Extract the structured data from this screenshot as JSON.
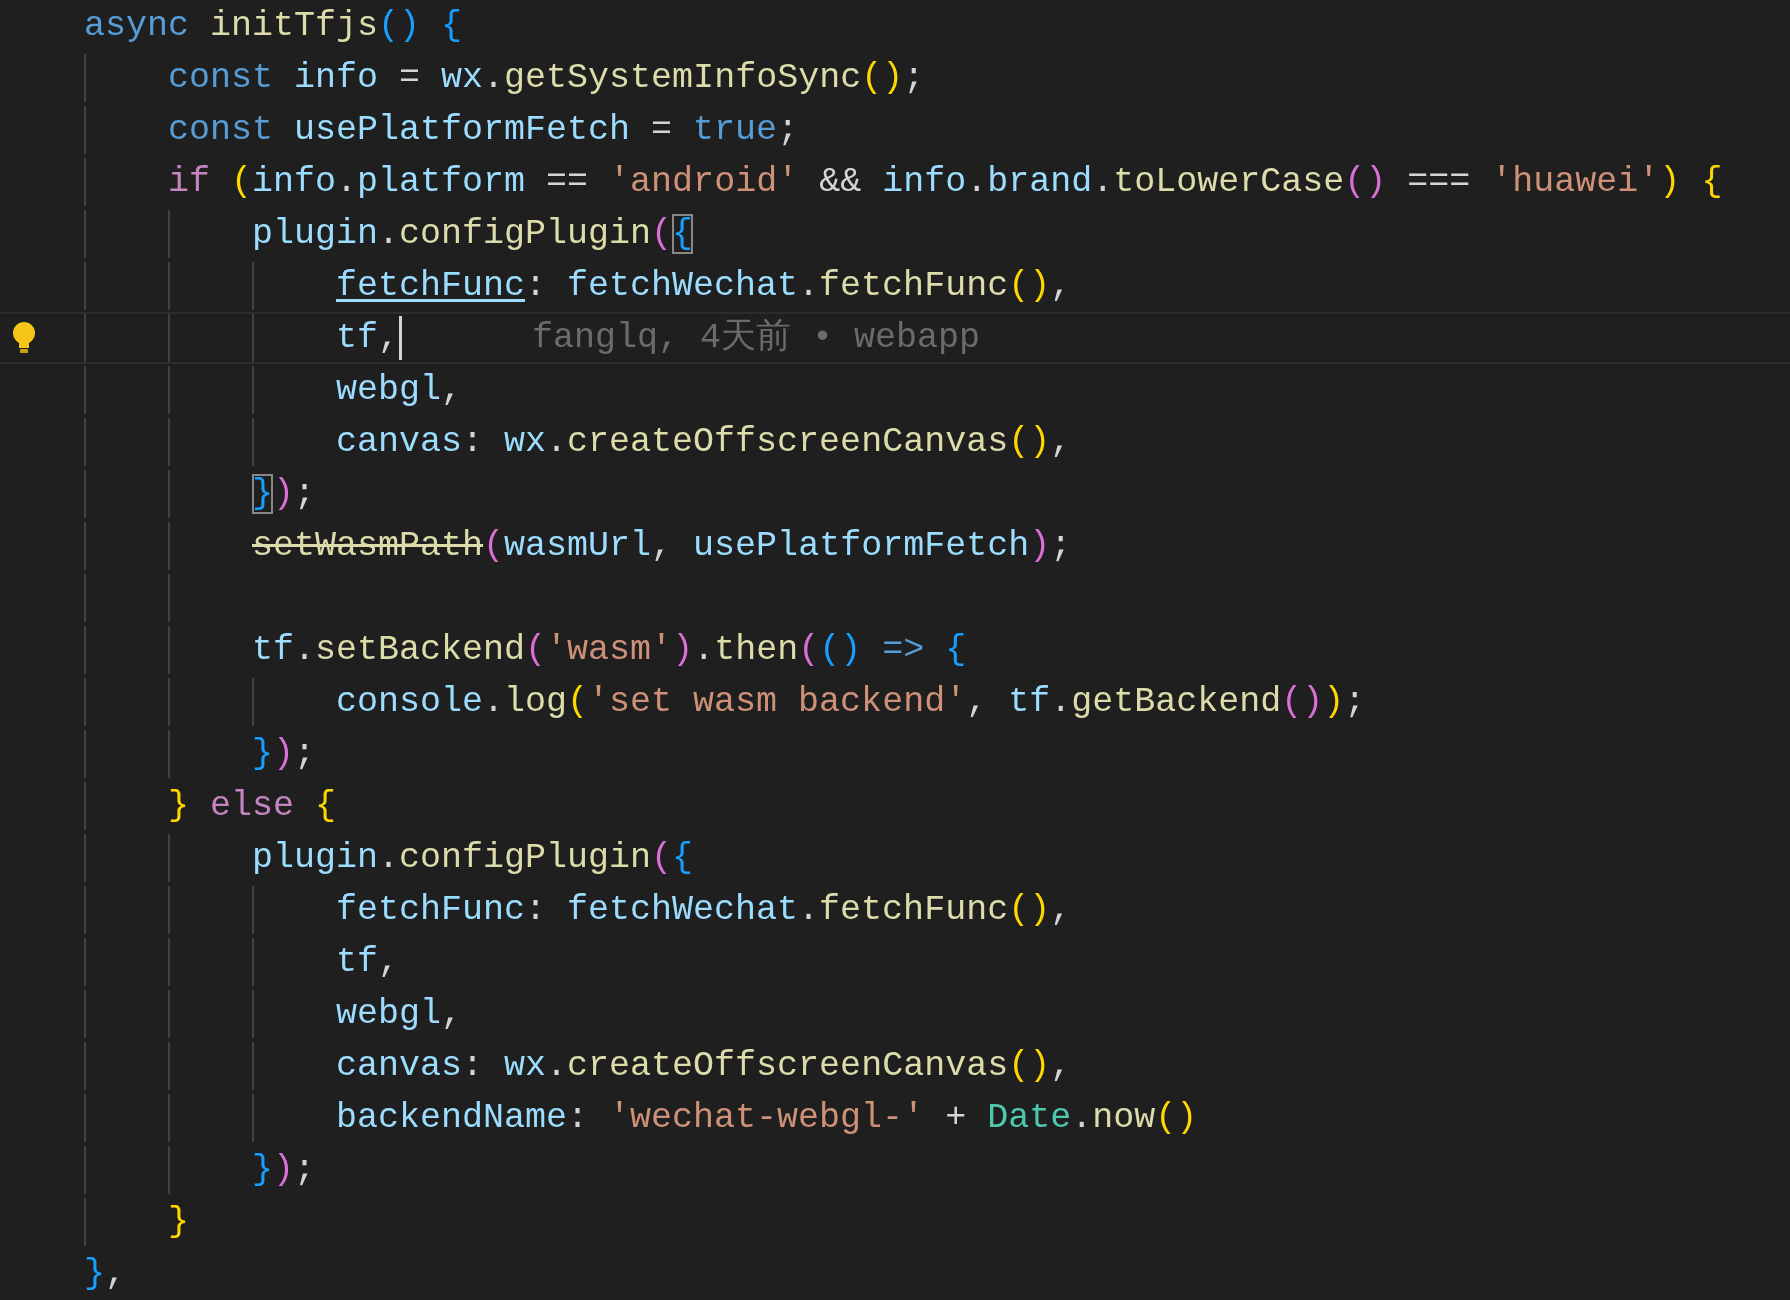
{
  "lines": [
    {
      "current": false,
      "tokens": [
        {
          "text": "async ",
          "kind": "keyword"
        },
        {
          "text": "initTfjs",
          "kind": "function"
        },
        {
          "text": "() ",
          "kind": "b3"
        },
        {
          "text": "{",
          "kind": "b3"
        }
      ],
      "children": [
        {
          "current": false,
          "tokens": [
            {
              "text": "const ",
              "kind": "keyword"
            },
            {
              "text": "info",
              "kind": "variable"
            },
            {
              "text": " = ",
              "kind": "plain"
            },
            {
              "text": "wx",
              "kind": "variable"
            },
            {
              "text": ".",
              "kind": "plain"
            },
            {
              "text": "getSystemInfoSync",
              "kind": "function"
            },
            {
              "text": "()",
              "kind": "b1"
            },
            {
              "text": ";",
              "kind": "plain"
            }
          ]
        },
        {
          "current": false,
          "tokens": [
            {
              "text": "const ",
              "kind": "keyword"
            },
            {
              "text": "usePlatformFetch",
              "kind": "variable"
            },
            {
              "text": " = ",
              "kind": "plain"
            },
            {
              "text": "true",
              "kind": "keyword"
            },
            {
              "text": ";",
              "kind": "plain"
            }
          ]
        },
        {
          "current": false,
          "tokens": [
            {
              "text": "if ",
              "kind": "control"
            },
            {
              "text": "(",
              "kind": "b1"
            },
            {
              "text": "info",
              "kind": "variable"
            },
            {
              "text": ".",
              "kind": "plain"
            },
            {
              "text": "platform",
              "kind": "variable"
            },
            {
              "text": " == ",
              "kind": "plain"
            },
            {
              "text": "'android'",
              "kind": "string"
            },
            {
              "text": " && ",
              "kind": "plain"
            },
            {
              "text": "info",
              "kind": "variable"
            },
            {
              "text": ".",
              "kind": "plain"
            },
            {
              "text": "brand",
              "kind": "variable"
            },
            {
              "text": ".",
              "kind": "plain"
            },
            {
              "text": "toLowerCase",
              "kind": "function"
            },
            {
              "text": "()",
              "kind": "b2"
            },
            {
              "text": " === ",
              "kind": "plain"
            },
            {
              "text": "'huawei'",
              "kind": "string"
            },
            {
              "text": ") ",
              "kind": "b1"
            },
            {
              "text": "{",
              "kind": "b1"
            }
          ],
          "children": [
            {
              "current": false,
              "tokens": [
                {
                  "text": "plugin",
                  "kind": "variable"
                },
                {
                  "text": ".",
                  "kind": "plain"
                },
                {
                  "text": "configPlugin",
                  "kind": "function"
                },
                {
                  "text": "(",
                  "kind": "b2"
                },
                {
                  "text": "{",
                  "kind": "b3",
                  "match": true
                }
              ],
              "children": [
                {
                  "current": false,
                  "tokens": [
                    {
                      "text": "fetchFunc",
                      "kind": "link"
                    },
                    {
                      "text": ": ",
                      "kind": "plain"
                    },
                    {
                      "text": "fetchWechat",
                      "kind": "variable"
                    },
                    {
                      "text": ".",
                      "kind": "plain"
                    },
                    {
                      "text": "fetchFunc",
                      "kind": "function"
                    },
                    {
                      "text": "()",
                      "kind": "b1"
                    },
                    {
                      "text": ",",
                      "kind": "plain"
                    }
                  ]
                },
                {
                  "current": true,
                  "blame": "fanglq, 4天前 • webapp",
                  "tokens": [
                    {
                      "text": "tf",
                      "kind": "variable"
                    },
                    {
                      "text": ",",
                      "kind": "plain"
                    }
                  ]
                },
                {
                  "current": false,
                  "tokens": [
                    {
                      "text": "webgl",
                      "kind": "variable"
                    },
                    {
                      "text": ",",
                      "kind": "plain"
                    }
                  ]
                },
                {
                  "current": false,
                  "tokens": [
                    {
                      "text": "canvas",
                      "kind": "variable"
                    },
                    {
                      "text": ": ",
                      "kind": "plain"
                    },
                    {
                      "text": "wx",
                      "kind": "variable"
                    },
                    {
                      "text": ".",
                      "kind": "plain"
                    },
                    {
                      "text": "createOffscreenCanvas",
                      "kind": "function"
                    },
                    {
                      "text": "()",
                      "kind": "b1"
                    },
                    {
                      "text": ",",
                      "kind": "plain"
                    }
                  ]
                }
              ]
            },
            {
              "current": false,
              "tokens": [
                {
                  "text": "}",
                  "kind": "b3",
                  "match": true
                },
                {
                  "text": ")",
                  "kind": "b2"
                },
                {
                  "text": ";",
                  "kind": "plain"
                }
              ]
            },
            {
              "current": false,
              "tokens": [
                {
                  "text": "setWasmPath",
                  "kind": "deprecated"
                },
                {
                  "text": "(",
                  "kind": "b2"
                },
                {
                  "text": "wasmUrl",
                  "kind": "variable"
                },
                {
                  "text": ", ",
                  "kind": "plain"
                },
                {
                  "text": "usePlatformFetch",
                  "kind": "variable"
                },
                {
                  "text": ")",
                  "kind": "b2"
                },
                {
                  "text": ";",
                  "kind": "plain"
                }
              ]
            },
            {
              "current": false
            },
            {
              "current": false,
              "tokens": [
                {
                  "text": "tf",
                  "kind": "variable"
                },
                {
                  "text": ".",
                  "kind": "plain"
                },
                {
                  "text": "setBackend",
                  "kind": "function"
                },
                {
                  "text": "(",
                  "kind": "b2"
                },
                {
                  "text": "'wasm'",
                  "kind": "string"
                },
                {
                  "text": ")",
                  "kind": "b2"
                },
                {
                  "text": ".",
                  "kind": "plain"
                },
                {
                  "text": "then",
                  "kind": "function"
                },
                {
                  "text": "(",
                  "kind": "b2"
                },
                {
                  "text": "() ",
                  "kind": "b3"
                },
                {
                  "text": "=> ",
                  "kind": "keyword"
                },
                {
                  "text": "{",
                  "kind": "b3"
                }
              ],
              "children": [
                {
                  "current": false,
                  "tokens": [
                    {
                      "text": "console",
                      "kind": "variable"
                    },
                    {
                      "text": ".",
                      "kind": "plain"
                    },
                    {
                      "text": "log",
                      "kind": "function"
                    },
                    {
                      "text": "(",
                      "kind": "b1"
                    },
                    {
                      "text": "'set wasm backend'",
                      "kind": "string"
                    },
                    {
                      "text": ", ",
                      "kind": "plain"
                    },
                    {
                      "text": "tf",
                      "kind": "variable"
                    },
                    {
                      "text": ".",
                      "kind": "plain"
                    },
                    {
                      "text": "getBackend",
                      "kind": "function"
                    },
                    {
                      "text": "()",
                      "kind": "b2"
                    },
                    {
                      "text": ")",
                      "kind": "b1"
                    },
                    {
                      "text": ";",
                      "kind": "plain"
                    }
                  ]
                }
              ]
            },
            {
              "current": false,
              "tokens": [
                {
                  "text": "}",
                  "kind": "b3"
                },
                {
                  "text": ")",
                  "kind": "b2"
                },
                {
                  "text": ";",
                  "kind": "plain"
                }
              ]
            }
          ]
        },
        {
          "current": false,
          "tokens": [
            {
              "text": "} ",
              "kind": "b1"
            },
            {
              "text": "else ",
              "kind": "control"
            },
            {
              "text": "{",
              "kind": "b1"
            }
          ],
          "children": [
            {
              "current": false,
              "tokens": [
                {
                  "text": "plugin",
                  "kind": "variable"
                },
                {
                  "text": ".",
                  "kind": "plain"
                },
                {
                  "text": "configPlugin",
                  "kind": "function"
                },
                {
                  "text": "(",
                  "kind": "b2"
                },
                {
                  "text": "{",
                  "kind": "b3"
                }
              ],
              "children": [
                {
                  "current": false,
                  "tokens": [
                    {
                      "text": "fetchFunc",
                      "kind": "variable"
                    },
                    {
                      "text": ": ",
                      "kind": "plain"
                    },
                    {
                      "text": "fetchWechat",
                      "kind": "variable"
                    },
                    {
                      "text": ".",
                      "kind": "plain"
                    },
                    {
                      "text": "fetchFunc",
                      "kind": "function"
                    },
                    {
                      "text": "()",
                      "kind": "b1"
                    },
                    {
                      "text": ",",
                      "kind": "plain"
                    }
                  ]
                },
                {
                  "current": false,
                  "tokens": [
                    {
                      "text": "tf",
                      "kind": "variable"
                    },
                    {
                      "text": ",",
                      "kind": "plain"
                    }
                  ]
                },
                {
                  "current": false,
                  "tokens": [
                    {
                      "text": "webgl",
                      "kind": "variable"
                    },
                    {
                      "text": ",",
                      "kind": "plain"
                    }
                  ]
                },
                {
                  "current": false,
                  "tokens": [
                    {
                      "text": "canvas",
                      "kind": "variable"
                    },
                    {
                      "text": ": ",
                      "kind": "plain"
                    },
                    {
                      "text": "wx",
                      "kind": "variable"
                    },
                    {
                      "text": ".",
                      "kind": "plain"
                    },
                    {
                      "text": "createOffscreenCanvas",
                      "kind": "function"
                    },
                    {
                      "text": "()",
                      "kind": "b1"
                    },
                    {
                      "text": ",",
                      "kind": "plain"
                    }
                  ]
                },
                {
                  "current": false,
                  "tokens": [
                    {
                      "text": "backendName",
                      "kind": "variable"
                    },
                    {
                      "text": ": ",
                      "kind": "plain"
                    },
                    {
                      "text": "'wechat-webgl-'",
                      "kind": "string"
                    },
                    {
                      "text": " + ",
                      "kind": "plain"
                    },
                    {
                      "text": "Date",
                      "kind": "class"
                    },
                    {
                      "text": ".",
                      "kind": "plain"
                    },
                    {
                      "text": "now",
                      "kind": "function"
                    },
                    {
                      "text": "()",
                      "kind": "b1"
                    }
                  ]
                }
              ]
            },
            {
              "current": false,
              "tokens": [
                {
                  "text": "}",
                  "kind": "b3"
                },
                {
                  "text": ")",
                  "kind": "b2"
                },
                {
                  "text": ";",
                  "kind": "plain"
                }
              ]
            }
          ]
        },
        {
          "current": false,
          "tokens": [
            {
              "text": "}",
              "kind": "b1"
            }
          ]
        }
      ]
    },
    {
      "current": false,
      "tokens": [
        {
          "text": "}",
          "kind": "b3"
        },
        {
          "text": ",",
          "kind": "plain"
        }
      ]
    }
  ]
}
